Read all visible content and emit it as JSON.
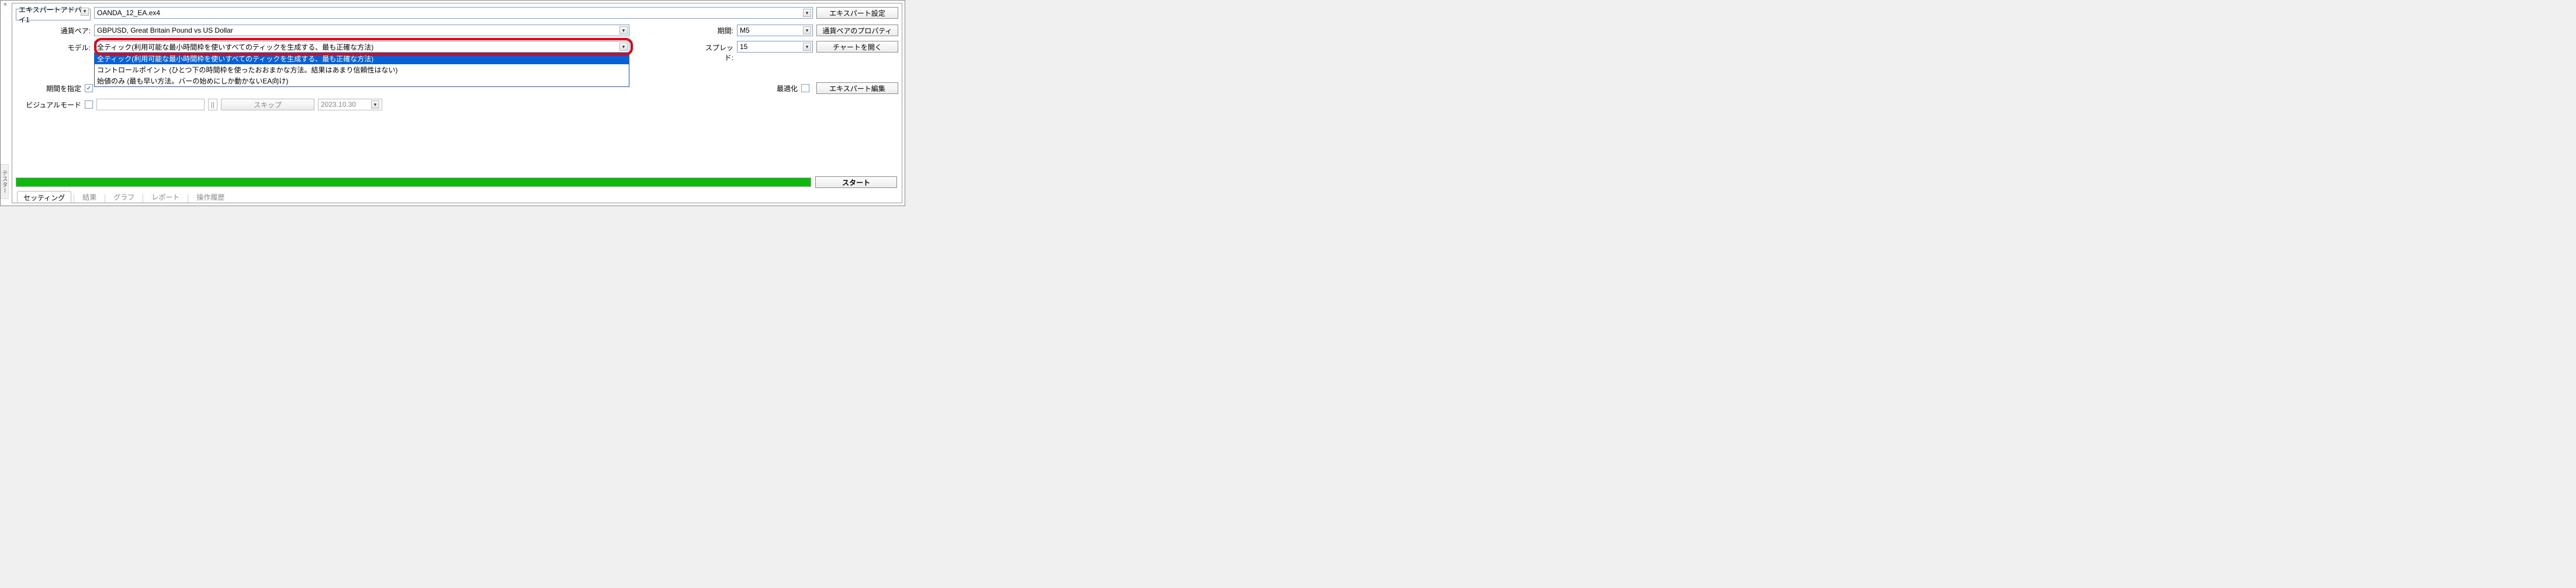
{
  "sideTab": "テスター",
  "rowEA": {
    "dropdownLabel": "エキスパートアドバイ1",
    "file": "OANDA_12_EA.ex4",
    "btn": "エキスパート設定"
  },
  "rowSymbol": {
    "label": "通貨ペア:",
    "value": "GBPUSD, Great Britain Pound vs US Dollar",
    "periodLabel": "期間:",
    "periodValue": "M5",
    "btn": "通貨ペアのプロパティ"
  },
  "rowModel": {
    "label": "モデル:",
    "selected": "全ティック(利用可能な最小時間枠を使いすべてのティックを生成する、最も正確な方法)",
    "options": [
      "全ティック(利用可能な最小時間枠を使いすべてのティックを生成する、最も正確な方法)",
      "コントロールポイント (ひとつ下の時間枠を使ったおおまかな方法。結果はあまり信頼性はない)",
      "始値のみ (最も早い方法。バーの始めにしか動かないEA向け)"
    ],
    "spreadLabel": "スプレッド:",
    "spreadValue": "15",
    "btn": "チャートを開く"
  },
  "rowPeriod": {
    "label": "期間を指定",
    "optimizeLabel": "最適化",
    "btn": "エキスパート編集"
  },
  "rowVisual": {
    "label": "ビジュアルモード",
    "skip": "スキップ",
    "date": "2023.10.30"
  },
  "startBtn": "スタート",
  "tabs": {
    "settings": "セッティング",
    "results": "結果",
    "graph": "グラフ",
    "report": "レポート",
    "journal": "操作履歴"
  }
}
